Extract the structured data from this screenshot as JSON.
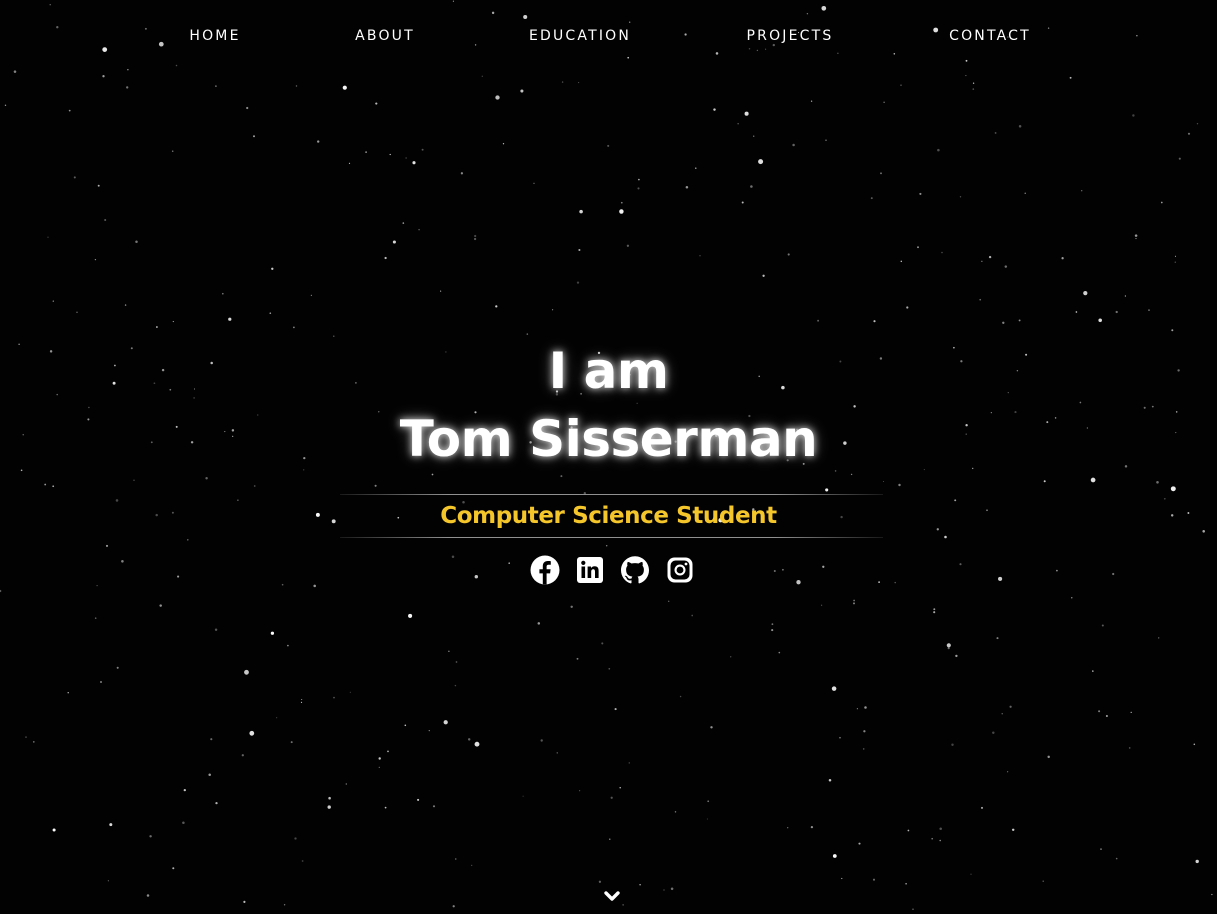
{
  "nav": {
    "items": [
      {
        "label": "HOME"
      },
      {
        "label": "ABOUT"
      },
      {
        "label": "EDUCATION"
      },
      {
        "label": "PROJECTS"
      },
      {
        "label": "CONTACT"
      }
    ]
  },
  "hero": {
    "line1": "I am",
    "line2": "Tom Sisserman",
    "subtitle": "Computer Science Student"
  },
  "social": {
    "items": [
      {
        "icon": "facebook-icon"
      },
      {
        "icon": "linkedin-icon"
      },
      {
        "icon": "github-icon"
      },
      {
        "icon": "instagram-icon"
      }
    ]
  },
  "scroll": {
    "icon": "chevron-down-icon"
  },
  "colors": {
    "background": "#020202",
    "text": "#ffffff",
    "accent": "#f5c62c"
  }
}
